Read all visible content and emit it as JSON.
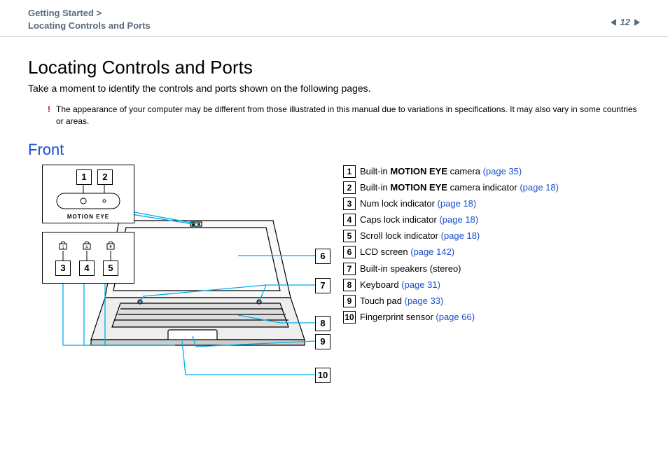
{
  "header": {
    "breadcrumb_line1": "Getting Started >",
    "breadcrumb_line2": "Locating Controls and Ports",
    "page_number": "12"
  },
  "title": "Locating Controls and Ports",
  "intro": "Take a moment to identify the controls and ports shown on the following pages.",
  "note": "The appearance of your computer may be different from those illustrated in this manual due to variations in specifications. It may also vary in some countries or areas.",
  "section": "Front",
  "diagram": {
    "inset1_label": "MOTION EYE",
    "callouts": [
      "1",
      "2",
      "3",
      "4",
      "5",
      "6",
      "7",
      "8",
      "9",
      "10"
    ]
  },
  "legend": [
    {
      "n": "1",
      "pre": "Built-in ",
      "bold": "MOTION EYE",
      "post": " camera ",
      "link": "(page 35)"
    },
    {
      "n": "2",
      "pre": "Built-in ",
      "bold": "MOTION EYE",
      "post": " camera indicator ",
      "link": "(page 18)"
    },
    {
      "n": "3",
      "pre": "Num lock indicator ",
      "bold": "",
      "post": "",
      "link": "(page 18)"
    },
    {
      "n": "4",
      "pre": "Caps lock indicator ",
      "bold": "",
      "post": "",
      "link": "(page 18)"
    },
    {
      "n": "5",
      "pre": "Scroll lock indicator ",
      "bold": "",
      "post": "",
      "link": "(page 18)"
    },
    {
      "n": "6",
      "pre": "LCD screen ",
      "bold": "",
      "post": "",
      "link": "(page 142)"
    },
    {
      "n": "7",
      "pre": "Built-in speakers (stereo)",
      "bold": "",
      "post": "",
      "link": ""
    },
    {
      "n": "8",
      "pre": "Keyboard ",
      "bold": "",
      "post": "",
      "link": "(page 31)"
    },
    {
      "n": "9",
      "pre": "Touch pad ",
      "bold": "",
      "post": "",
      "link": "(page 33)"
    },
    {
      "n": "10",
      "pre": "Fingerprint sensor ",
      "bold": "",
      "post": "",
      "link": "(page 66)"
    }
  ]
}
